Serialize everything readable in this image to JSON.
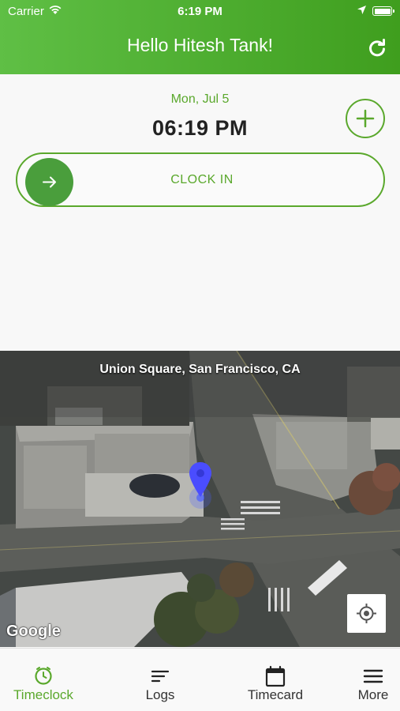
{
  "status_bar": {
    "carrier": "Carrier",
    "time": "6:19 PM"
  },
  "header": {
    "greeting": "Hello Hitesh Tank!"
  },
  "clock": {
    "date": "Mon, Jul 5",
    "time": "06:19 PM",
    "clock_in_label": "CLOCK IN"
  },
  "map": {
    "location": "Union Square, San Francisco, CA",
    "attribution": "Google"
  },
  "tabs": [
    {
      "label": "Timeclock",
      "icon": "timeclock-icon",
      "active": true
    },
    {
      "label": "Logs",
      "icon": "logs-icon",
      "active": false
    },
    {
      "label": "Timecard",
      "icon": "calendar-icon",
      "active": false
    },
    {
      "label": "More",
      "icon": "menu-icon",
      "active": false
    }
  ],
  "colors": {
    "accent": "#5aa82c",
    "header_start": "#5fbf45",
    "header_end": "#3f9e1e",
    "pin": "#4a5fff"
  }
}
